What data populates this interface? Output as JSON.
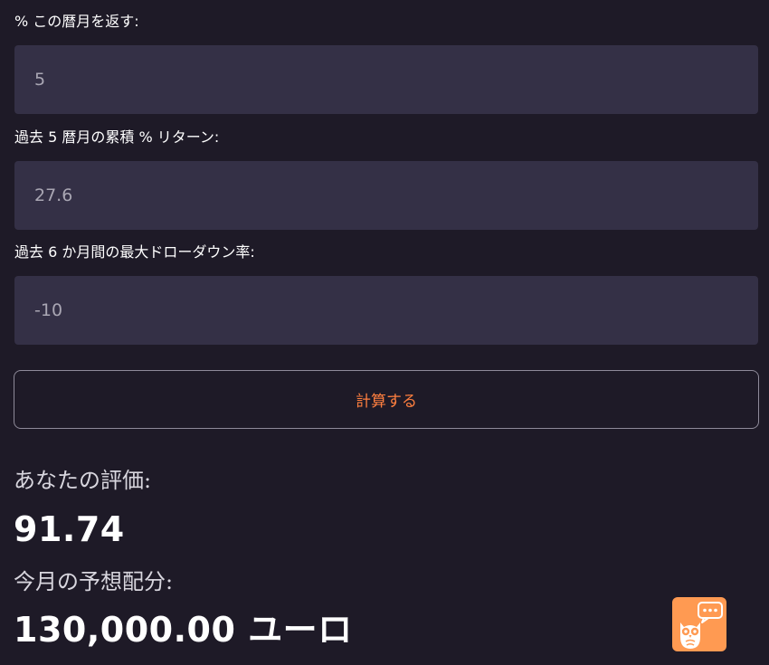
{
  "form": {
    "fields": [
      {
        "label": "% この暦月を返す:",
        "value": "5"
      },
      {
        "label": "過去 5 暦月の累積 % リターン:",
        "value": "27.6"
      },
      {
        "label": "過去 6 か月間の最大ドローダウン率:",
        "value": "-10"
      }
    ],
    "calculate_label": "計算する"
  },
  "results": {
    "rating_heading": "あなたの評価:",
    "rating_value": "91.74",
    "distribution_heading": "今月の予想配分:",
    "distribution_value": "130,000.00 ユーロ"
  },
  "widget": {
    "icon": "owl-chat-icon",
    "color": "#ff9a52"
  },
  "colors": {
    "background": "#1e1a27",
    "input_background": "#343046",
    "button_text": "#ff7f3f",
    "button_border": "#8e8a99"
  }
}
